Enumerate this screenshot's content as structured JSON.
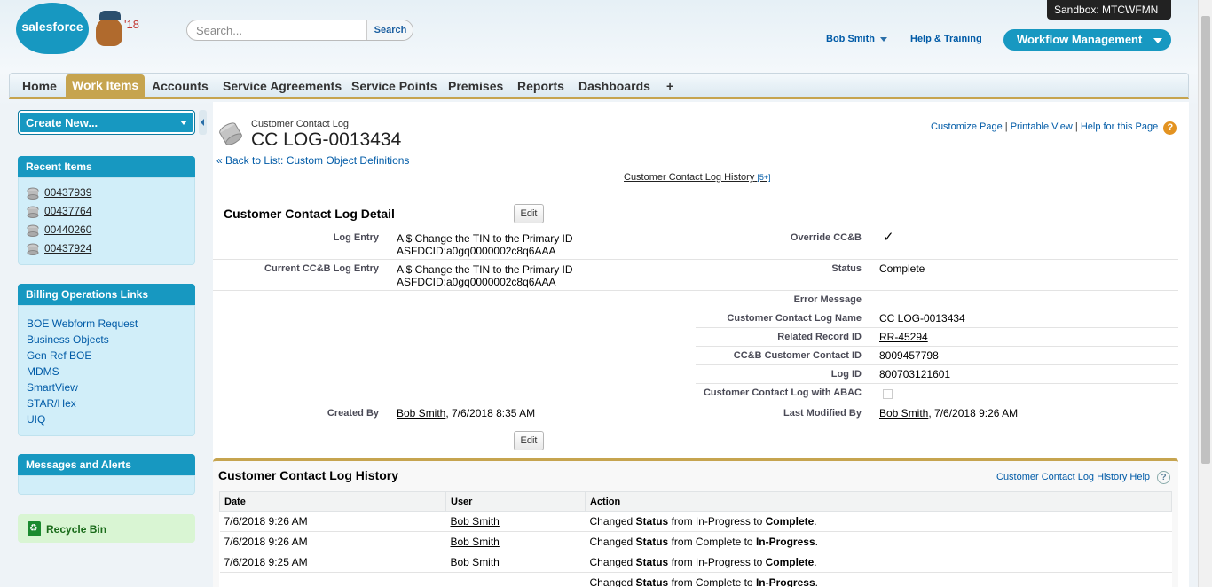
{
  "header": {
    "logo_text": "salesforce",
    "mascot_year": "'18",
    "search": {
      "placeholder": "Search...",
      "button": "Search"
    },
    "sandbox": "Sandbox:   MTCWFMN",
    "user": "Bob Smith",
    "help": "Help & Training",
    "app": "Workflow Management"
  },
  "tabs": [
    "Home",
    "Work Items",
    "Accounts",
    "Service Agreements",
    "Service Points",
    "Premises",
    "Reports",
    "Dashboards",
    "+"
  ],
  "sidebar": {
    "create_new": "Create New...",
    "recent_title": "Recent Items",
    "recent_items": [
      "00437939",
      "00437764",
      "00440260",
      "00437924"
    ],
    "billing_title": "Billing Operations Links",
    "billing_links": [
      "BOE Webform Request",
      "Business Objects",
      "Gen Ref BOE",
      "MDMS",
      "SmartView",
      "STAR/Hex",
      "UIQ"
    ],
    "messages_title": "Messages and Alerts",
    "recycle": "Recycle Bin"
  },
  "page": {
    "type": "Customer Contact Log",
    "title": "CC LOG-0013434",
    "back_link": "« Back to List: Custom Object Definitions",
    "customize": "Customize Page",
    "printable": "Printable View",
    "help_page": "Help for this Page",
    "sep": "|",
    "history_link": "Customer Contact Log History",
    "history_count": "[5+]"
  },
  "detail": {
    "title": "Customer Contact Log Detail",
    "edit_label": "Edit",
    "log_entry_label": "Log Entry",
    "log_entry_line1": "A $ Change the TIN to the Primary ID",
    "log_entry_line2": "ASFDCID:a0gq0000002c8q6AAA",
    "current_log_label": "Current CC&B Log Entry",
    "current_log_line1": "A $ Change the TIN to the Primary ID",
    "current_log_line2": "ASFDCID:a0gq0000002c8q6AAA",
    "override_label": "Override CC&B",
    "override_value": "✓",
    "status_label": "Status",
    "status_value": "Complete",
    "error_label": "Error Message",
    "error_value": "",
    "name_label": "Customer Contact Log Name",
    "name_value": "CC LOG-0013434",
    "related_label": "Related Record ID",
    "related_value": "RR-45294",
    "ccb_id_label": "CC&B Customer Contact ID",
    "ccb_id_value": "8009457798",
    "log_id_label": "Log ID",
    "log_id_value": "800703121601",
    "abac_label": "Customer Contact Log with ABAC",
    "created_label": "Created By",
    "created_user": "Bob Smith",
    "created_date": ", 7/6/2018 8:35 AM",
    "modified_label": "Last Modified By",
    "modified_user": "Bob Smith",
    "modified_date": ", 7/6/2018 9:26 AM"
  },
  "history": {
    "title": "Customer Contact Log History",
    "help": "Customer Contact Log History Help",
    "columns": [
      "Date",
      "User",
      "Action"
    ],
    "rows": [
      {
        "date": "7/6/2018 9:26 AM",
        "user": "Bob Smith",
        "a1": "Changed ",
        "field": "Status",
        "a2": " from In-Progress to ",
        "to": "Complete",
        "end": "."
      },
      {
        "date": "7/6/2018 9:26 AM",
        "user": "Bob Smith",
        "a1": "Changed ",
        "field": "Status",
        "a2": " from Complete to ",
        "to": "In-Progress",
        "end": "."
      },
      {
        "date": "7/6/2018 9:25 AM",
        "user": "Bob Smith",
        "a1": "Changed ",
        "field": "Status",
        "a2": " from In-Progress to ",
        "to": "Complete",
        "end": "."
      },
      {
        "date": "",
        "user": "",
        "a1": "Changed ",
        "field": "Status",
        "a2": " from Complete to ",
        "to": "In-Progress",
        "end": "."
      }
    ]
  },
  "colors": {
    "brand_blue": "#1798c1",
    "tab_gold": "#c6a44f",
    "link": "#015ba7",
    "sidebar_bg": "#d1eef9",
    "recycle_bg": "#d9f5d3"
  }
}
